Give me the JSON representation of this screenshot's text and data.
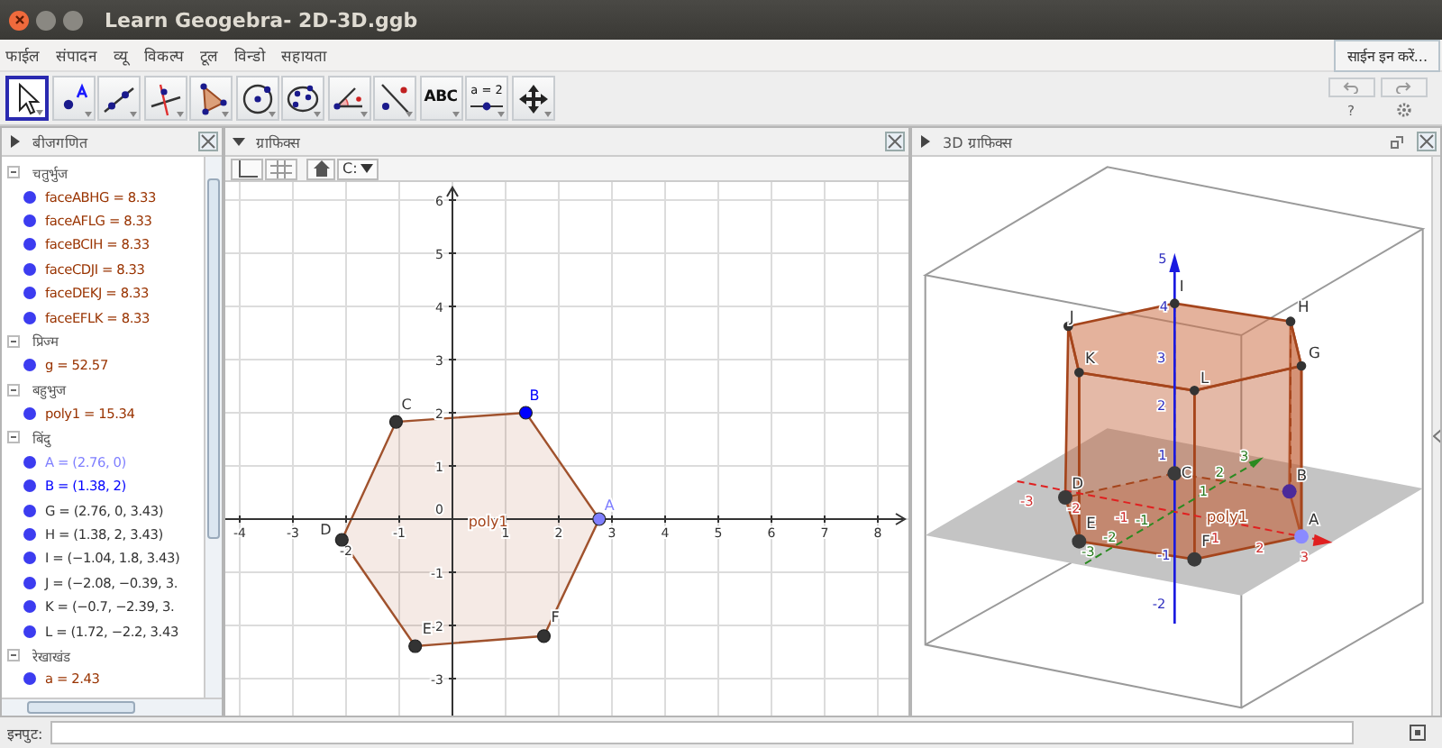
{
  "window": {
    "title": "Learn Geogebra- 2D-3D.ggb"
  },
  "menu": [
    "फाईल",
    "संपादन",
    "व्यू",
    "विकल्प",
    "टूल",
    "विन्डो",
    "सहायता"
  ],
  "sign_in": "साईन इन करें...",
  "tools": [
    {
      "kind": "move",
      "selected": true
    },
    {
      "kind": "point",
      "selected": false
    },
    {
      "kind": "line",
      "selected": false
    },
    {
      "kind": "perpendicular",
      "selected": false
    },
    {
      "kind": "polygon",
      "selected": false
    },
    {
      "kind": "circle",
      "selected": false
    },
    {
      "kind": "conic",
      "selected": false
    },
    {
      "kind": "angle",
      "selected": false
    },
    {
      "kind": "reflect",
      "selected": false
    },
    {
      "kind": "text",
      "label": "ABC",
      "selected": false
    },
    {
      "kind": "slider",
      "label": "a = 2",
      "selected": false
    },
    {
      "kind": "move_view",
      "selected": false
    }
  ],
  "toolbar_right": {
    "help": "?"
  },
  "algebra": {
    "title": "बीजगणित",
    "groups": [
      {
        "label": "चतुर्भुज",
        "expanded": true,
        "children": [
          {
            "text": "faceABHG = 8.33",
            "color": "#993300"
          },
          {
            "text": "faceAFLG = 8.33",
            "color": "#993300"
          },
          {
            "text": "faceBCIH = 8.33",
            "color": "#993300"
          },
          {
            "text": "faceCDJI = 8.33",
            "color": "#993300"
          },
          {
            "text": "faceDEKJ = 8.33",
            "color": "#993300"
          },
          {
            "text": "faceEFLK = 8.33",
            "color": "#993300"
          }
        ]
      },
      {
        "label": "प्रिज्म",
        "expanded": true,
        "children": [
          {
            "text": "g = 52.57",
            "color": "#993300"
          }
        ]
      },
      {
        "label": "बहुभुज",
        "expanded": true,
        "children": [
          {
            "text": "poly1 = 15.34",
            "color": "#993300"
          }
        ]
      },
      {
        "label": "बिंदु",
        "expanded": true,
        "children": [
          {
            "text": "A = (2.76, 0)",
            "color": "#7f7fff"
          },
          {
            "text": "B = (1.38, 2)",
            "color": "#0000ff"
          },
          {
            "text": "G = (2.76, 0, 3.43)",
            "color": "#333333"
          },
          {
            "text": "H = (1.38, 2, 3.43)",
            "color": "#333333"
          },
          {
            "text": "I = (−1.04, 1.8, 3.43)",
            "color": "#333333"
          },
          {
            "text": "J = (−2.08, −0.39, 3.",
            "color": "#333333"
          },
          {
            "text": "K = (−0.7, −2.39, 3.",
            "color": "#333333"
          },
          {
            "text": "L = (1.72, −2.2, 3.43",
            "color": "#333333"
          }
        ]
      },
      {
        "label": "रेखाखंड",
        "expanded": true,
        "children": [
          {
            "text": "a = 2.43",
            "color": "#993300"
          }
        ]
      }
    ]
  },
  "graphics": {
    "title": "ग्राफिक्स",
    "point_style": "C:",
    "x_ticks": [
      "-4",
      "-3",
      "-2",
      "-1",
      "1",
      "2",
      "3",
      "4",
      "5",
      "6",
      "7",
      "8"
    ],
    "y_ticks": [
      "6",
      "5",
      "4",
      "3",
      "2",
      "1",
      "-1",
      "-2",
      "-3"
    ],
    "origin_label": "0",
    "points": [
      {
        "label": "A",
        "color": "#7f7fff"
      },
      {
        "label": "B",
        "color": "#0000ff"
      },
      {
        "label": "C",
        "color": "#333333"
      },
      {
        "label": "D",
        "color": "#333333"
      },
      {
        "label": "E",
        "color": "#333333"
      },
      {
        "label": "F",
        "color": "#333333"
      }
    ],
    "polygon_label": "poly1"
  },
  "graphics_3d": {
    "title": "3D ग्राफिक्स",
    "points": [
      {
        "label": "I"
      },
      {
        "label": "H"
      },
      {
        "label": "J"
      },
      {
        "label": "K"
      },
      {
        "label": "G"
      },
      {
        "label": "L"
      },
      {
        "label": "C"
      },
      {
        "label": "D"
      },
      {
        "label": "B"
      },
      {
        "label": "E"
      },
      {
        "label": "F"
      },
      {
        "label": "A"
      }
    ],
    "z_ticks": [
      "5",
      "4",
      "3",
      "2",
      "1",
      "-1",
      "-2"
    ],
    "x_ticks": [
      "-3",
      "-2",
      "-1",
      "1",
      "2",
      "3"
    ],
    "y_ticks": [
      "-3",
      "-2",
      "-1",
      "1",
      "2",
      "3"
    ],
    "polygon_label": "poly1"
  },
  "input_bar": {
    "label": "इनपुट:"
  }
}
